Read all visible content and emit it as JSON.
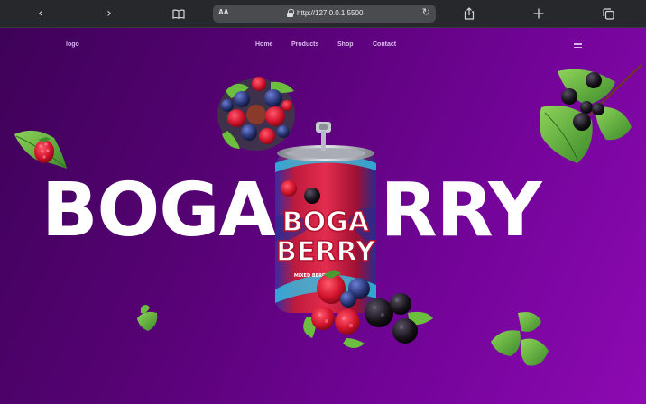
{
  "browser": {
    "url": "http://127.0.0.1:5500",
    "aa_label": "AA",
    "icons": [
      "chevron-left-icon",
      "chevron-right-icon",
      "book-icon",
      "lock-icon",
      "reload-icon",
      "share-icon",
      "plus-icon",
      "tabs-icon"
    ]
  },
  "nav": {
    "logo": "logo",
    "links": [
      "Home",
      "Products",
      "Shop",
      "Contact"
    ],
    "menu_icon": "hamburger-icon"
  },
  "hero": {
    "headline": "BOGABERRY",
    "can_label_line1": "BOGA",
    "can_label_line2": "BERRY",
    "can_small_text": "MIXED BERRY"
  },
  "colors": {
    "background_start": "#3e0258",
    "background_end": "#8d0ab2",
    "nav_text": "#d9b4ee",
    "headline": "#ffffff"
  }
}
